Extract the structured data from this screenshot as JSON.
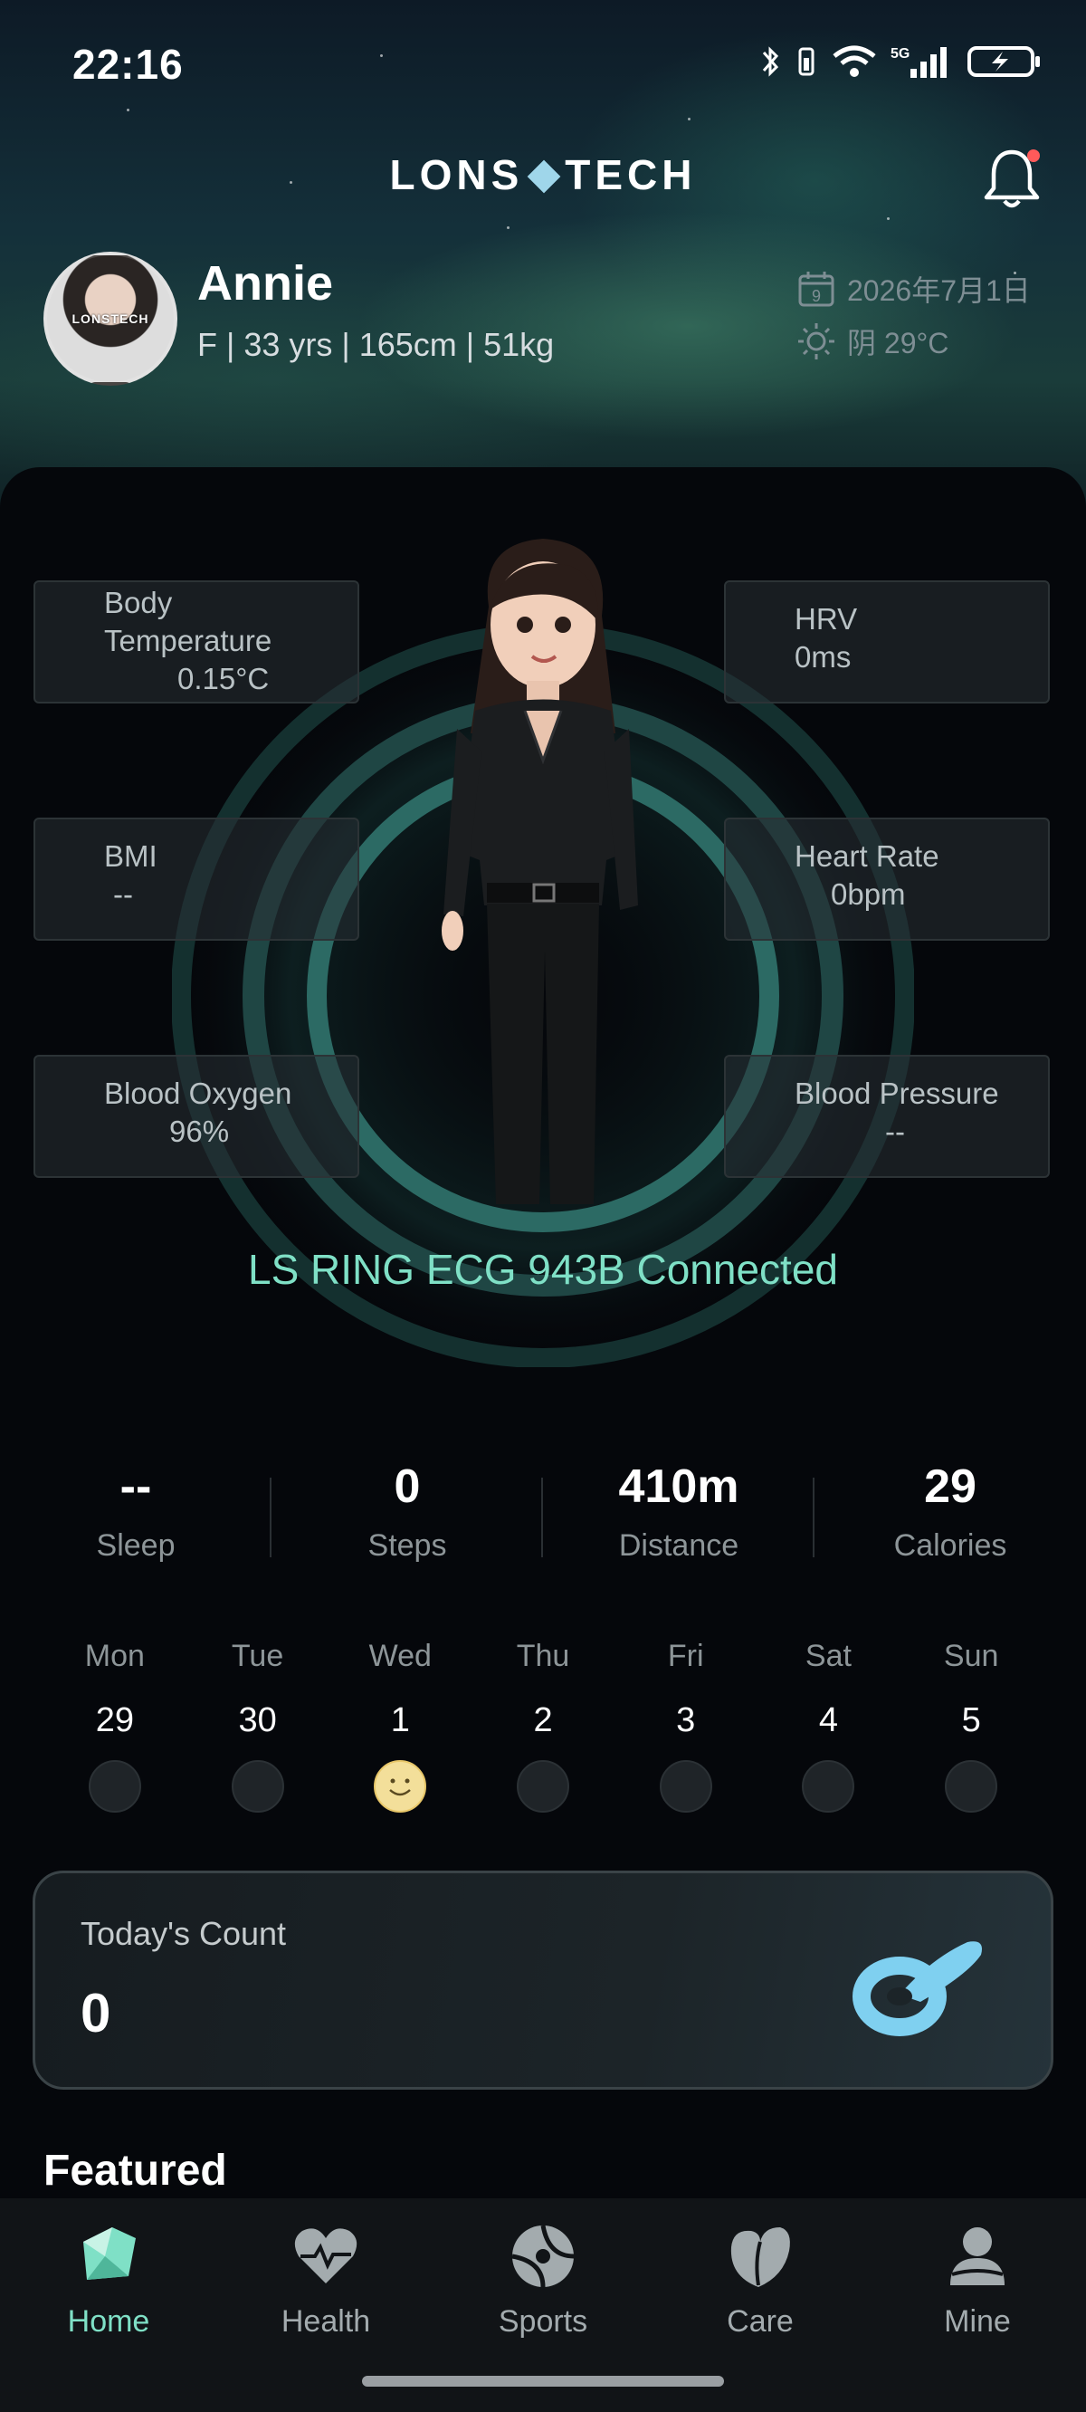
{
  "status_bar": {
    "time": "22:16"
  },
  "header": {
    "logo_left": "LONS",
    "logo_right": "TECH"
  },
  "user": {
    "avatar_label": "LONSTECH",
    "name": "Annie",
    "info": "F | 33 yrs | 165cm | 51kg"
  },
  "info": {
    "date_icon_day": "9",
    "date": "2026年7月1日",
    "weather": "阴 29°C"
  },
  "metrics": {
    "body_temperature": {
      "label_line1": "Body",
      "label_line2": "Temperature",
      "value": "0.15°C"
    },
    "hrv": {
      "label": "HRV",
      "value": "0ms"
    },
    "bmi": {
      "label": "BMI",
      "value": "--"
    },
    "heart_rate": {
      "label": "Heart Rate",
      "value": "0bpm"
    },
    "blood_oxygen": {
      "label": "Blood Oxygen",
      "value": "96%"
    },
    "blood_pressure": {
      "label": "Blood Pressure",
      "value": "--"
    }
  },
  "device_status": "LS RING ECG 943B Connected",
  "stats": [
    {
      "value": "--",
      "label": "Sleep"
    },
    {
      "value": "0",
      "label": "Steps"
    },
    {
      "value": "410m",
      "label": "Distance"
    },
    {
      "value": "29",
      "label": "Calories"
    }
  ],
  "week": [
    {
      "name": "Mon",
      "date": "29"
    },
    {
      "name": "Tue",
      "date": "30"
    },
    {
      "name": "Wed",
      "date": "1"
    },
    {
      "name": "Thu",
      "date": "2"
    },
    {
      "name": "Fri",
      "date": "3"
    },
    {
      "name": "Sat",
      "date": "4"
    },
    {
      "name": "Sun",
      "date": "5"
    }
  ],
  "today_count": {
    "title": "Today's Count",
    "value": "0"
  },
  "featured_title": "Featured",
  "tabs": [
    {
      "label": "Home"
    },
    {
      "label": "Health"
    },
    {
      "label": "Sports"
    },
    {
      "label": "Care"
    },
    {
      "label": "Mine"
    }
  ],
  "colors": {
    "accent": "#7fe0c6",
    "background": "#05070b",
    "notification_dot": "#ff5a5a"
  }
}
